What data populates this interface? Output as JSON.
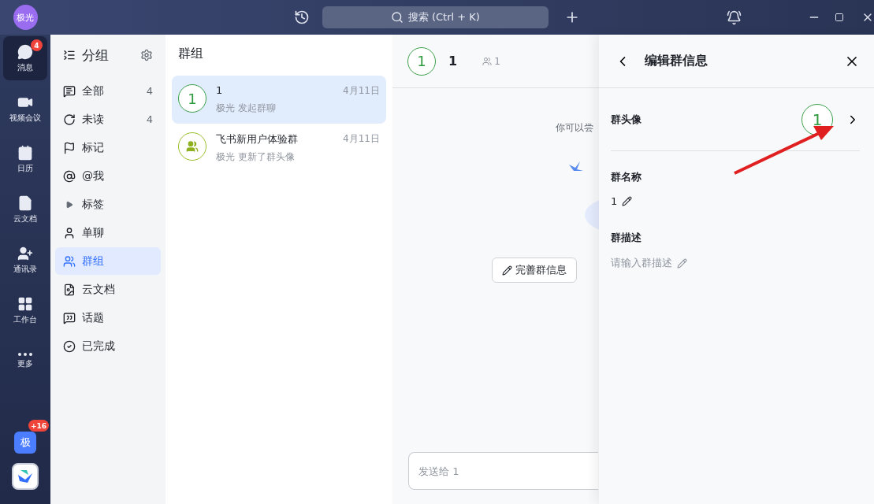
{
  "titlebar": {
    "avatar": "极光",
    "search": {
      "placeholder": "搜索 (Ctrl + K)"
    }
  },
  "rail": {
    "items": [
      {
        "label": "消息",
        "selected": true,
        "badge": "4"
      },
      {
        "label": "视频会议",
        "selected": false
      },
      {
        "label": "日历",
        "selected": false
      },
      {
        "label": "云文档",
        "selected": false
      },
      {
        "label": "通讯录",
        "selected": false
      },
      {
        "label": "工作台",
        "selected": false
      },
      {
        "label": "更多",
        "selected": false
      }
    ],
    "account": {
      "label": "极",
      "badge": "+16"
    }
  },
  "groups": {
    "title": "分组",
    "items": [
      {
        "kind": "filter",
        "label": "全部",
        "count": "4",
        "selected": false
      },
      {
        "kind": "filter",
        "label": "未读",
        "count": "4",
        "selected": false
      },
      {
        "kind": "filter",
        "label": "标记",
        "selected": false
      },
      {
        "kind": "filter",
        "label": "@我",
        "selected": false
      },
      {
        "kind": "folder",
        "label": "标签",
        "expanded": false,
        "selected": false
      },
      {
        "kind": "filter",
        "label": "单聊",
        "selected": false
      },
      {
        "kind": "filter",
        "label": "群组",
        "selected": true
      },
      {
        "kind": "filter",
        "label": "云文档",
        "selected": false
      },
      {
        "kind": "filter",
        "label": "话题",
        "selected": false
      },
      {
        "kind": "filter",
        "label": "已完成",
        "selected": false
      }
    ]
  },
  "chat_list": {
    "title": "群组",
    "items": [
      {
        "kind": "number",
        "avatar": "1",
        "name": "1",
        "date": "4月11日",
        "preview": "极光 发起群聊",
        "selected": true
      },
      {
        "kind": "people",
        "name": "飞书新用户体验群",
        "date": "4月11日",
        "preview": "极光 更新了群头像",
        "selected": false
      }
    ]
  },
  "chat": {
    "avatar": "1",
    "name": "1",
    "members": "1",
    "hint": "你可以尝",
    "actions": [
      "完善群信息"
    ],
    "composer": {
      "placeholder": "发送给 1"
    }
  },
  "edit_panel": {
    "title": "编辑群信息",
    "avatar_label": "群头像",
    "avatar": "1",
    "name_label": "群名称",
    "name": "1",
    "description_label": "群描述",
    "description_placeholder": "请输入群描述"
  }
}
